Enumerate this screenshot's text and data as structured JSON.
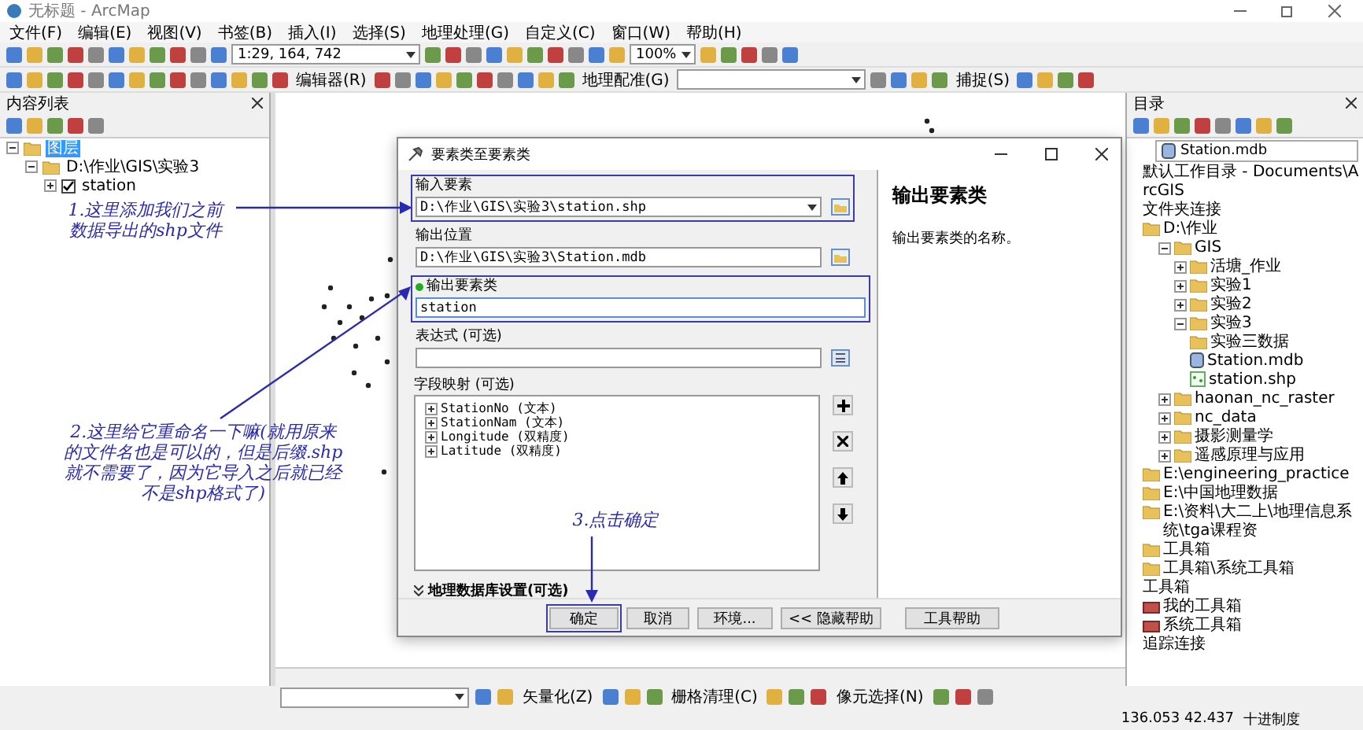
{
  "window": {
    "title": "无标题 - ArcMap"
  },
  "menu": [
    "文件(F)",
    "编辑(E)",
    "视图(V)",
    "书签(B)",
    "插入(I)",
    "选择(S)",
    "地理处理(G)",
    "自定义(C)",
    "窗口(W)",
    "帮助(H)"
  ],
  "toolbar": {
    "scale": "1:29, 164, 742",
    "zoom": "100%",
    "editor": "编辑器(R)",
    "georef": "地理配准(G)",
    "snapping": "捕捉(S)"
  },
  "toc": {
    "title": "内容列表",
    "tree": [
      {
        "label": "图层",
        "selected": true,
        "children": [
          {
            "label": "D:\\作业\\GIS\\实验3",
            "children": [
              {
                "label": "station",
                "checked": true
              }
            ]
          }
        ]
      }
    ]
  },
  "dialog": {
    "title": "要素类至要素类",
    "fields": [
      {
        "label": "输入要素",
        "value": "D:\\作业\\GIS\\实验3\\station.shp",
        "kind": "dropdown"
      },
      {
        "label": "输出位置",
        "value": "D:\\作业\\GIS\\实验3\\Station.mdb",
        "kind": "browse"
      },
      {
        "label": "输出要素类",
        "value": "station",
        "kind": "text"
      },
      {
        "label": "表达式 (可选)",
        "kind": "sql"
      }
    ],
    "mapping_label": "字段映射 (可选)",
    "mapping": [
      "StationNo (文本)",
      "StationNam (文本)",
      "Longitude (双精度)",
      "Latitude (双精度)"
    ],
    "geodb_settings": "地理数据库设置(可选)",
    "buttons": [
      "确定",
      "取消",
      "环境...",
      "<< 隐藏帮助",
      "工具帮助"
    ],
    "help_title": "输出要素类",
    "help_text": "输出要素类的名称。"
  },
  "catalog": {
    "title": "目录",
    "location": "Station.mdb",
    "tree": [
      {
        "label": "默认工作目录 - Documents\\ArcGIS",
        "kind": "plain"
      },
      {
        "label": "文件夹连接",
        "kind": "plain"
      },
      {
        "label": "D:\\作业",
        "kind": "folder",
        "children": [
          {
            "label": "GIS",
            "kind": "folder",
            "children": [
              {
                "label": "活塘_作业",
                "kind": "folder"
              },
              {
                "label": "实验1",
                "kind": "folder"
              },
              {
                "label": "实验2",
                "kind": "folder"
              },
              {
                "label": "实验3",
                "kind": "folder",
                "children": [
                  {
                    "label": "实验三数据",
                    "kind": "folder"
                  },
                  {
                    "label": "Station.mdb",
                    "kind": "database"
                  },
                  {
                    "label": "station.shp",
                    "kind": "shapefile"
                  }
                ]
              }
            ]
          },
          {
            "label": "haonan_nc_raster",
            "kind": "folder"
          },
          {
            "label": "nc_data",
            "kind": "folder"
          },
          {
            "label": "摄影测量学",
            "kind": "folder"
          },
          {
            "label": "遥感原理与应用",
            "kind": "folder"
          }
        ]
      },
      {
        "label": "E:\\engineering_practice",
        "kind": "folder"
      },
      {
        "label": "E:\\中国地理数据",
        "kind": "folder"
      },
      {
        "label": "E:\\资料\\大二上\\地理信息系统\\tga课程资",
        "kind": "folder"
      },
      {
        "label": "工具箱",
        "kind": "folder"
      },
      {
        "label": "工具箱\\系统工具箱",
        "kind": "folder"
      },
      {
        "label": "工具箱",
        "kind": "plain"
      },
      {
        "label": "我的工具箱",
        "kind": "toolbox"
      },
      {
        "label": "系统工具箱",
        "kind": "toolbox"
      },
      {
        "label": "追踪连接",
        "kind": "plain"
      }
    ]
  },
  "annotations": [
    {
      "text": "1.这里添加我们之前数据导出的shp文件"
    },
    {
      "text": "2.这里给它重命名一下嘛(就用原来的文件名也是可以的，但是后缀.shp就不需要了，因为它导入之后就已经不是shp格式了)"
    },
    {
      "text": "3.点击确定"
    }
  ],
  "bottom_toolbar": [
    "矢量化(Z)",
    "栅格清理(C)",
    "像元选择(N)"
  ],
  "status": {
    "coordinates": "136.053  42.437",
    "units": "十进制度"
  }
}
